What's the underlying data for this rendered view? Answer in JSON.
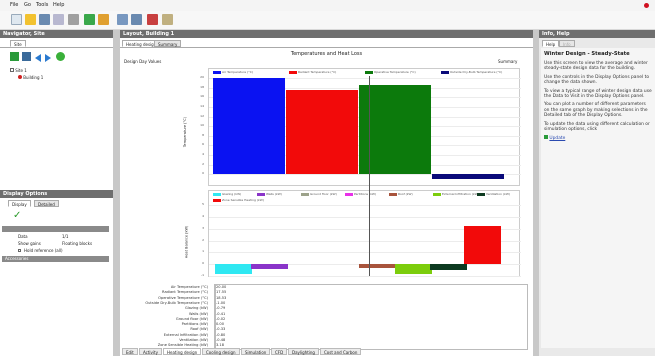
{
  "menu": [
    "File",
    "Go",
    "Tools",
    "Help"
  ],
  "left": {
    "nav_title": "Navigator, Site",
    "nav_tab": "Site",
    "tree_root": "Site 1",
    "tree_child": "Building 1",
    "display_title": "Display Options",
    "display_tabs": [
      "Display",
      "Detailed"
    ],
    "options": [
      {
        "label": "Data",
        "value": "1/1"
      },
      {
        "label": "Show gains",
        "value": "Floating blocks"
      },
      {
        "label": "Hold reference (all)",
        "value": ""
      },
      {
        "label": "Accessories",
        "value": ""
      }
    ]
  },
  "center": {
    "title": "Layout, Building 1",
    "top_tabs": [
      "Heating design",
      "Summary"
    ],
    "chart_title": "Temperatures and Heat Loss",
    "left_note": "Design Day Values",
    "right_note": "Summary",
    "bottom_tabs": [
      "Edit",
      "Activity",
      "Heating design",
      "Cooling design",
      "Simulation",
      "CFD",
      "Daylighting",
      "Cost and Carbon"
    ]
  },
  "chart_data": [
    {
      "type": "bar",
      "series": [
        {
          "name": "Air Temperature (°C)",
          "color": "#0a12f2",
          "value": 20.0
        },
        {
          "name": "Radiant Temperature (°C)",
          "color": "#f20a0a",
          "value": 17.5
        },
        {
          "name": "Operative Temperature (°C)",
          "color": "#0c7a0c",
          "value": 18.5
        },
        {
          "name": "Outside Dry-Bulb Temperature (°C)",
          "color": "#0a0a7a",
          "value": -1.0
        }
      ],
      "ylabel": "Temperature (°C)",
      "ylim": [
        -2,
        20
      ],
      "ticks": [
        20,
        18,
        16,
        14,
        12,
        10,
        8,
        6,
        4,
        2,
        0
      ]
    },
    {
      "type": "bar",
      "series": [
        {
          "name": "Glazing (kW)",
          "color": "#2fe8f2",
          "value": -0.8
        },
        {
          "name": "Walls (kW)",
          "color": "#8a34c9",
          "value": -0.4
        },
        {
          "name": "Ground floor (kW)",
          "color": "#9ca28a",
          "value": 0.0
        },
        {
          "name": "Partitions (kW)",
          "color": "#e830e8",
          "value": 0.0
        },
        {
          "name": "Roof (kW)",
          "color": "#a8543c",
          "value": -0.3
        },
        {
          "name": "External Infiltration (kW)",
          "color": "#7ccd0c",
          "value": -0.8
        },
        {
          "name": "Ventilation (kW)",
          "color": "#0d3a20",
          "value": -0.5
        },
        {
          "name": "Zone Sensible Heating (kW)",
          "color": "#f20a0a",
          "value": 3.2
        }
      ],
      "ylabel": "Heat Balance (kW)",
      "ylim": [
        -1,
        5
      ],
      "ticks": [
        5,
        4,
        3,
        2,
        1,
        0,
        -1
      ]
    }
  ],
  "table": [
    {
      "label": "Air Temperature (°C)",
      "value": "20.00"
    },
    {
      "label": "Radiant Temperature (°C)",
      "value": "17.55"
    },
    {
      "label": "Operative Temperature (°C)",
      "value": "18.53"
    },
    {
      "label": "Outside Dry-Bulb Temperature (°C)",
      "value": "-1.00"
    },
    {
      "label": "Glazing (kW)",
      "value": "-0.79"
    },
    {
      "label": "Walls (kW)",
      "value": "-0.41"
    },
    {
      "label": "Ground floor (kW)",
      "value": "-0.02"
    },
    {
      "label": "Partitions (kW)",
      "value": "0.00"
    },
    {
      "label": "Roof (kW)",
      "value": "-0.33"
    },
    {
      "label": "External Infiltration (kW)",
      "value": "-0.80"
    },
    {
      "label": "Ventilation (kW)",
      "value": "-0.48"
    },
    {
      "label": "Zone Sensible Heating (kW)",
      "value": "3.18"
    }
  ],
  "right": {
    "title": "Info, Help",
    "tabs": [
      "Help",
      "Info"
    ],
    "heading": "Winter Design - Steady-State",
    "paragraphs": [
      "Use this screen to view the average and winter steady-state design data for the building.",
      "Use the controls in the Display Options panel to change the data shown.",
      "To view a typical range of winter design data use the Data to Visit in the Display Options panel.",
      "You can plot a number of different parameters on the same graph by making selections in the Detailed tab of the Display Options.",
      "To update the data using different calculation or simulation options, click"
    ],
    "update_label": "Update"
  }
}
